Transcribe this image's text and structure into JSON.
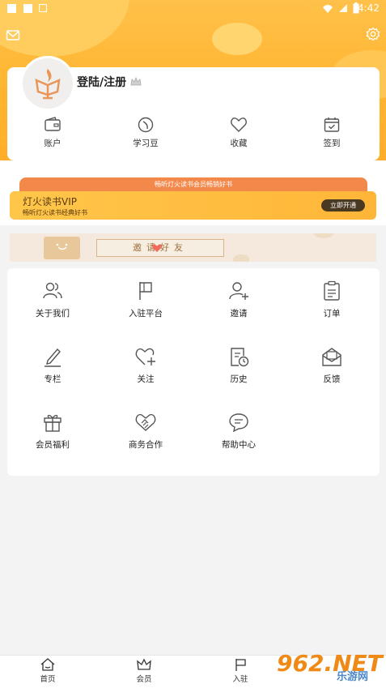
{
  "status": {
    "time": "4:42"
  },
  "profile": {
    "login_label": "登陆/注册"
  },
  "quick_actions": [
    {
      "label": "账户",
      "icon": "wallet-icon"
    },
    {
      "label": "学习豆",
      "icon": "bean-icon"
    },
    {
      "label": "收藏",
      "icon": "heart-icon"
    },
    {
      "label": "签到",
      "icon": "calendar-check-icon"
    }
  ],
  "vip": {
    "strip_text": "畅听灯火读书会员畅销好书",
    "title": "灯火读书VIP",
    "subtitle": "畅听灯火读书经典好书",
    "button": "立即开通"
  },
  "invite": {
    "text": "邀请好友"
  },
  "menu": [
    {
      "label": "关于我们",
      "icon": "users-icon"
    },
    {
      "label": "入驻平台",
      "icon": "flag-icon"
    },
    {
      "label": "邀请",
      "icon": "user-plus-icon"
    },
    {
      "label": "订单",
      "icon": "clipboard-icon"
    },
    {
      "label": "专栏",
      "icon": "pencil-icon"
    },
    {
      "label": "关注",
      "icon": "heart-plus-icon"
    },
    {
      "label": "历史",
      "icon": "history-icon"
    },
    {
      "label": "反馈",
      "icon": "mail-icon"
    },
    {
      "label": "会员福利",
      "icon": "gift-icon"
    },
    {
      "label": "商务合作",
      "icon": "handshake-icon"
    },
    {
      "label": "帮助中心",
      "icon": "chat-icon"
    }
  ],
  "bottom_nav": [
    {
      "label": "首页",
      "icon": "home-icon"
    },
    {
      "label": "会员",
      "icon": "crown-icon"
    },
    {
      "label": "入驻",
      "icon": "flag-icon"
    }
  ],
  "watermark": {
    "text": "962.NET",
    "subtext": "乐游网"
  }
}
